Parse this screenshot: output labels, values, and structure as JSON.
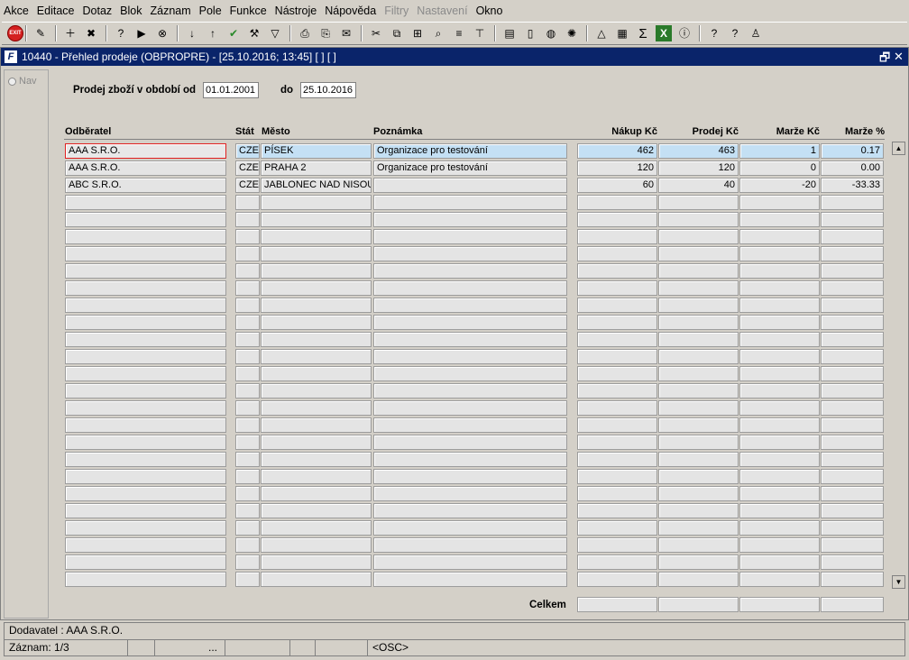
{
  "menu": [
    "Akce",
    "Editace",
    "Dotaz",
    "Blok",
    "Záznam",
    "Pole",
    "Funkce",
    "Nástroje",
    "Nápověda",
    "Filtry",
    "Nastavení",
    "Okno"
  ],
  "menu_disabled": [
    "Filtry",
    "Nastavení"
  ],
  "toolbar": {
    "exit_label": "EXIT",
    "icons": [
      "user-edit-icon",
      "add-record-icon",
      "delete-record-icon",
      "query-enter-icon",
      "query-execute-icon",
      "query-cancel-icon",
      "sort-asc-icon",
      "sort-desc-icon",
      "accept-icon",
      "wrench-icon",
      "filter-icon",
      "print-icon",
      "print-preview-icon",
      "mail-icon",
      "cut-icon",
      "copy-icon",
      "paste-icon",
      "find-icon",
      "list-icon",
      "tree-icon",
      "clipboard-icon",
      "document-icon",
      "globe-icon",
      "settings-icon",
      "chart-icon",
      "calendar-icon",
      "sum-icon",
      "excel-icon",
      "info-icon",
      "help-icon",
      "context-help-icon",
      "user-icon"
    ]
  },
  "window": {
    "title": "10440 - Přehled prodeje (OBPROPRE) - [25.10.2016; 13:45]  [ ]  [ ]",
    "restore_glyph": "🗗",
    "close_glyph": "✕"
  },
  "nav_label": "Nav",
  "filter": {
    "from_label": "Prodej zboží v období od",
    "from_value": "01.01.2001",
    "to_label": "do",
    "to_value": "25.10.2016"
  },
  "columns": [
    "Odběratel",
    "Stát",
    "Město",
    "Poznámka",
    "Nákup Kč",
    "Prodej Kč",
    "Marže Kč",
    "Marže %"
  ],
  "rows": [
    [
      "AAA S.R.O.",
      "CZE",
      "PÍSEK",
      "Organizace pro testování",
      "462",
      "463",
      "1",
      "0.17"
    ],
    [
      "AAA S.R.O.",
      "CZE",
      "PRAHA 2",
      "Organizace pro testování",
      "120",
      "120",
      "0",
      "0.00"
    ],
    [
      "ABC S.R.O.",
      "CZE",
      "JABLONEC NAD NISOU",
      "",
      "60",
      "40",
      "-20",
      "-33.33"
    ]
  ],
  "total_label": "Celkem",
  "status": {
    "line1": "Dodavatel : AAA S.R.O.",
    "record": "Záznam: 1/3",
    "ellipsis": "...",
    "mode": "<OSC>"
  }
}
